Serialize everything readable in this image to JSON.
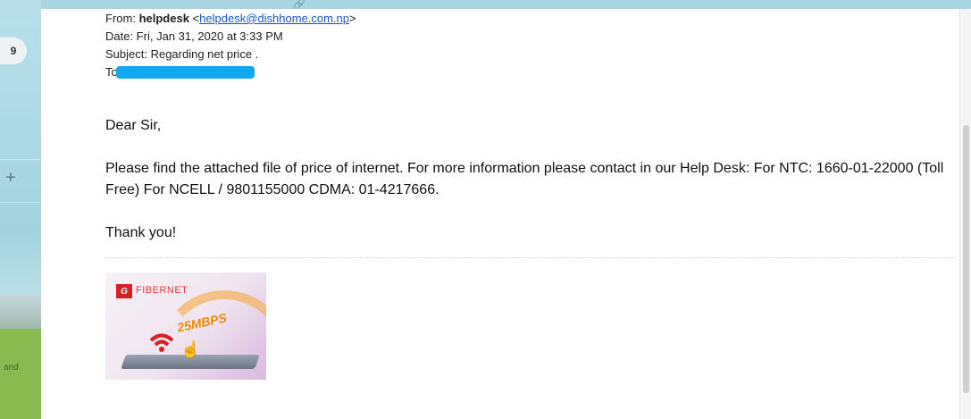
{
  "sidebar": {
    "badge_count": "9",
    "plus_symbol": "+",
    "footer_text": "and"
  },
  "top": {
    "glyph": "🔗"
  },
  "email": {
    "from_label": "From:",
    "from_name": "helpdesk",
    "from_email": "helpdesk@dishhome.com.np",
    "date_line": "Date: Fri, Jan 31, 2020 at 3:33 PM",
    "subject_line": "Subject: Regarding net price .",
    "to_label": "To:",
    "greeting": "Dear Sir,",
    "body": "Please find the attached file of price of internet. For more information please contact in our Help Desk: For NTC: 1660-01-22000 (Toll Free) For NCELL / 9801155000 CDMA: 01-4217666.",
    "signoff": "Thank you!"
  },
  "banner": {
    "logo_mark": "G",
    "brand": "FIBERNET",
    "speed": "25MBPS"
  },
  "colors": {
    "redaction": "#11a8f0",
    "link": "#1a55c8",
    "brand_red": "#d61f26",
    "speed_orange": "#f08a00"
  }
}
